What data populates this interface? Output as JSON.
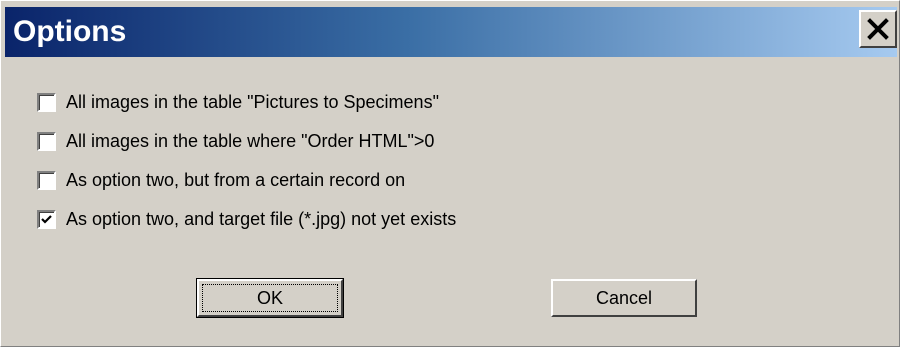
{
  "window": {
    "title": "Options",
    "close_icon": "close-icon"
  },
  "options": [
    {
      "label": "All images in the table \"Pictures to Specimens\"",
      "checked": false
    },
    {
      "label": "All images in the table where \"Order HTML\">0",
      "checked": false
    },
    {
      "label": "As option two, but from a certain record on",
      "checked": false
    },
    {
      "label": "As option two, and target file (*.jpg) not yet exists",
      "checked": true
    }
  ],
  "buttons": {
    "ok_label": "OK",
    "cancel_label": "Cancel"
  },
  "colors": {
    "title_gradient_start": "#0a246a",
    "title_gradient_end": "#a6caf0",
    "dialog_face": "#d4d0c8"
  }
}
